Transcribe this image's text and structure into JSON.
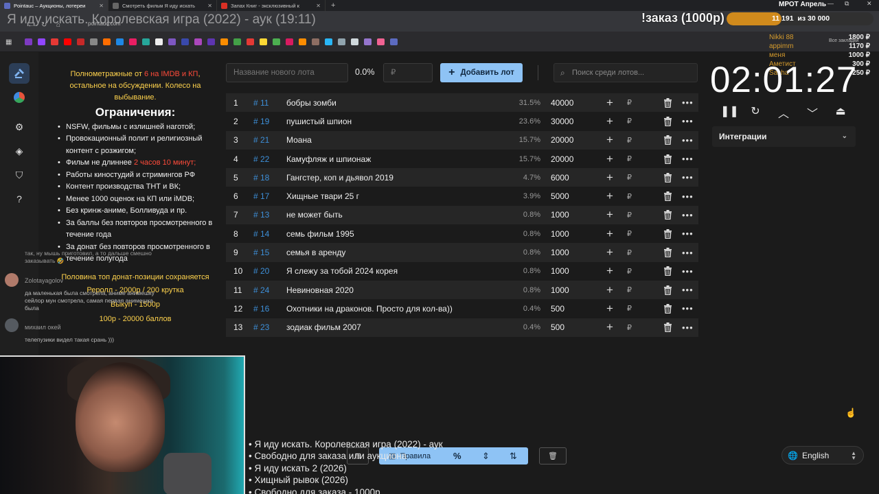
{
  "browser": {
    "tabs": [
      {
        "title": "Pointauc – Аукционы, лотереи",
        "active": true,
        "color": "#5c6bc0"
      },
      {
        "title": "Смотреть фильм Я иду искать",
        "active": false,
        "color": "#444444"
      },
      {
        "title": "Запах Книг - эксклюзивный к",
        "active": false,
        "color": "#d93025"
      }
    ],
    "new_tab": "+",
    "address": "pointauc.com",
    "bookmarks_right": "Все закладки"
  },
  "overlay": {
    "stream_title": "Я иду искать. Королевская игра (2022) - аук (19:11)",
    "order_label": "!заказ (1000р)",
    "goal_current": "11 191",
    "goal_target": "из 30 000",
    "goal_progress": 0.373,
    "mrot": "МРОТ Апрель",
    "donors": [
      "Nikki 88",
      "appimm",
      "меня",
      "Аметист",
      "Sasha"
    ],
    "donor_amounts": [
      "1800 ₽",
      "1170 ₽",
      "1000 ₽",
      "300 ₽",
      "250 ₽"
    ]
  },
  "rail": {
    "items": [
      "hammer-icon",
      "wheel-icon",
      "gear-icon",
      "layers-icon",
      "shield-icon",
      "help-icon"
    ]
  },
  "rules": {
    "intro_1": "Полнометражные от",
    "intro_red": "6 на IMDB и КП",
    "intro_2": ", остальное на обсуждении. Колесо на выбывание.",
    "heading": "Ограничения:",
    "items": [
      "NSFW, фильмы с излишней наготой;",
      "Провокационный полит и религиозный контент с розжигом;",
      "Фильм не длиннее",
      "Работы киностудий и стримингов РФ",
      "Контент производства ТНТ и ВК;",
      "Менее 1000 оценок на КП или iMDB;",
      "Без кринж-аниме, Болливуда и пр.",
      "За баллы без повторов просмотренного в течение года",
      "За донат без повторов просмотренного в течение полугода"
    ],
    "duration_red": "2 часов 10 минут;",
    "note": "Половина топ донат-позиции сохраняется",
    "prices": [
      "Реролл - 2000р / 200 крутка",
      "Выкуп - 1500р",
      "100р - 20000 баллов"
    ]
  },
  "chat": {
    "msg1": "так, ну мышь приготовил, а то дальше смешно заказывать 🤣",
    "user2": "Zolotayagolov",
    "msg2": "да маленькая была смотрела, аниме анимешку сейлор мун смотрела, самая первая анимешка была",
    "user3": "михаил окей",
    "msg3": "телепузики видел такая срань )))"
  },
  "lot_form": {
    "name_placeholder": "Название нового лота",
    "percent_total": "0.0%",
    "sum_placeholder": "₽",
    "add_label": "Добавить лот",
    "search_placeholder": "Поиск среди лотов..."
  },
  "lots": [
    {
      "n": "1",
      "id": "# 11",
      "name": "бобры зомби",
      "pct": "31.5%",
      "amount": "40000"
    },
    {
      "n": "2",
      "id": "# 19",
      "name": "пушистый шпион",
      "pct": "23.6%",
      "amount": "30000"
    },
    {
      "n": "3",
      "id": "# 21",
      "name": "Моана",
      "pct": "15.7%",
      "amount": "20000"
    },
    {
      "n": "4",
      "id": "# 22",
      "name": "Камуфляж и шпионаж",
      "pct": "15.7%",
      "amount": "20000"
    },
    {
      "n": "5",
      "id": "# 18",
      "name": "Гангстер, коп и дьявол 2019",
      "pct": "4.7%",
      "amount": "6000"
    },
    {
      "n": "6",
      "id": "# 17",
      "name": "Хищные твари 25 г",
      "pct": "3.9%",
      "amount": "5000"
    },
    {
      "n": "7",
      "id": "# 13",
      "name": "не может быть",
      "pct": "0.8%",
      "amount": "1000"
    },
    {
      "n": "8",
      "id": "# 14",
      "name": "семь фильм 1995",
      "pct": "0.8%",
      "amount": "1000"
    },
    {
      "n": "9",
      "id": "# 15",
      "name": "семья в аренду",
      "pct": "0.8%",
      "amount": "1000"
    },
    {
      "n": "10",
      "id": "# 20",
      "name": "Я слежу за тобой 2024  корея",
      "pct": "0.8%",
      "amount": "1000"
    },
    {
      "n": "11",
      "id": "# 24",
      "name": "Невиновная 2020",
      "pct": "0.8%",
      "amount": "1000"
    },
    {
      "n": "12",
      "id": "# 16",
      "name": "Охотники на драконов.  Просто для кол-ва))",
      "pct": "0.4%",
      "amount": "500"
    },
    {
      "n": "13",
      "id": "# 23",
      "name": "зодиак фильм 2007",
      "pct": "0.4%",
      "amount": "500"
    }
  ],
  "lot_currency": "₽",
  "timer": {
    "value": "02:01:27",
    "integrations_label": "Интеграции"
  },
  "queue": [
    "• Я иду искать. Королевская игра (2022) - аук",
    "• Свободно для заказа или аукциона",
    "• Я иду искать 2 (2026)",
    "• Хищный рывок (2026)",
    "• Свободно для заказа - 1000р"
  ],
  "toolbar": {
    "rules_label": "Правила"
  },
  "language": {
    "selected": "English"
  }
}
